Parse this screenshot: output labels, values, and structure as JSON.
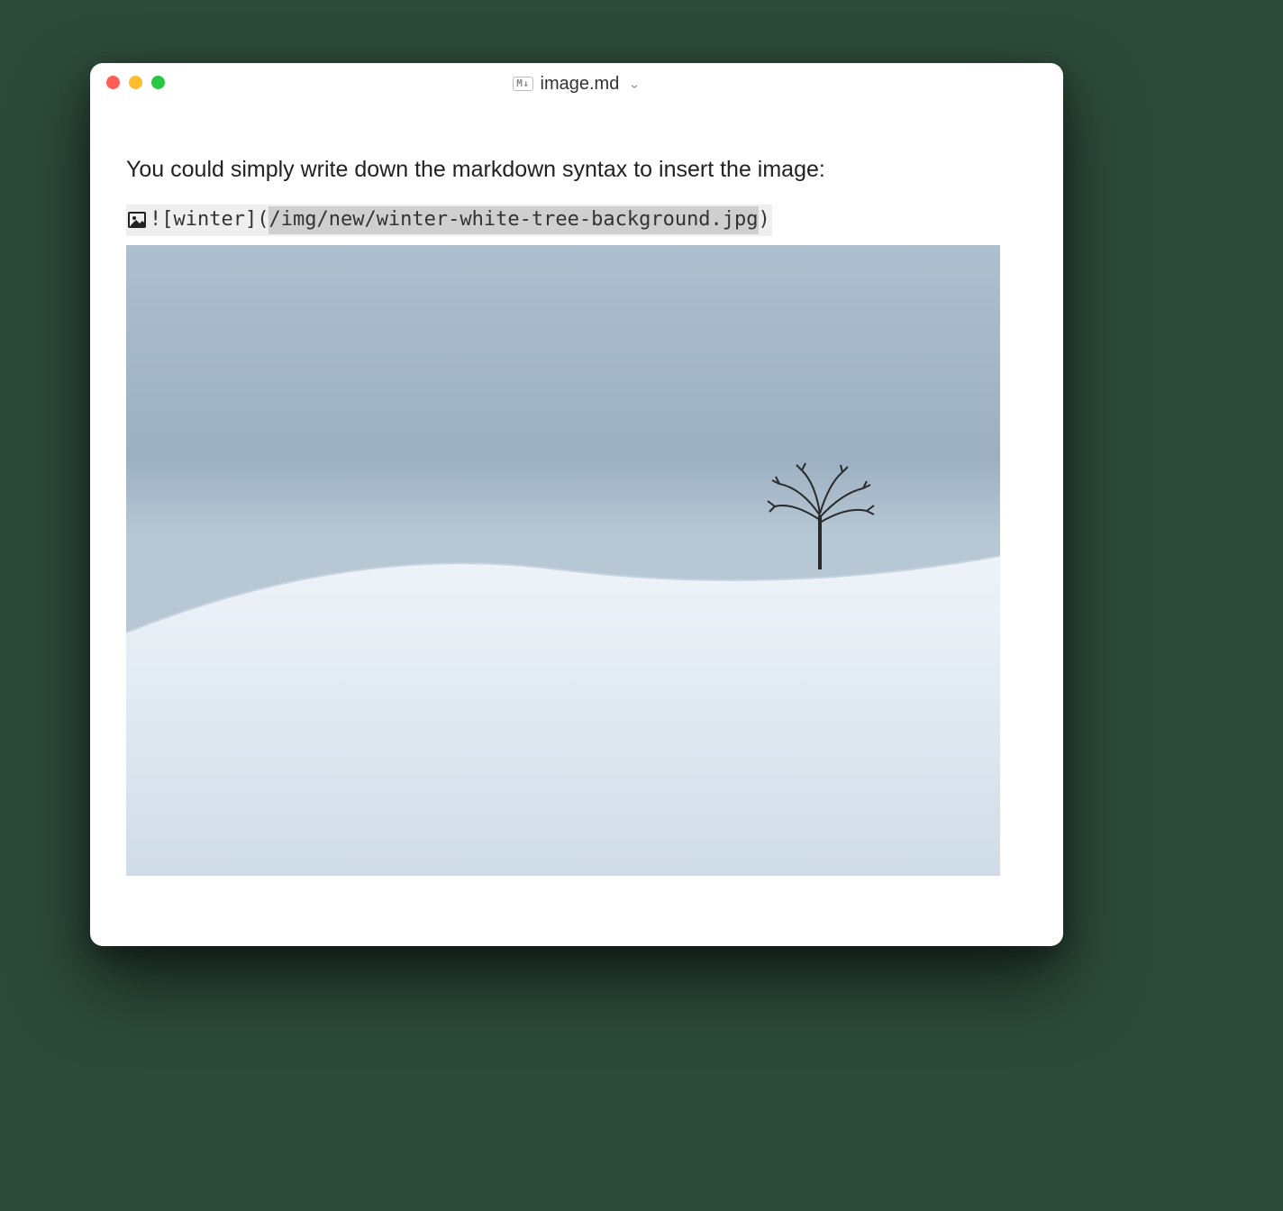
{
  "window": {
    "filetype_badge": "M↓",
    "title": "image.md",
    "dropdown_glyph": "⌄"
  },
  "document": {
    "lead_text": "You could simply write down the markdown syntax to insert the image:",
    "markdown": {
      "prefix": "![",
      "alt": "winter",
      "mid1": "](",
      "path": "/img/new/winter-white-tree-background.jpg",
      "suffix": ")"
    }
  }
}
